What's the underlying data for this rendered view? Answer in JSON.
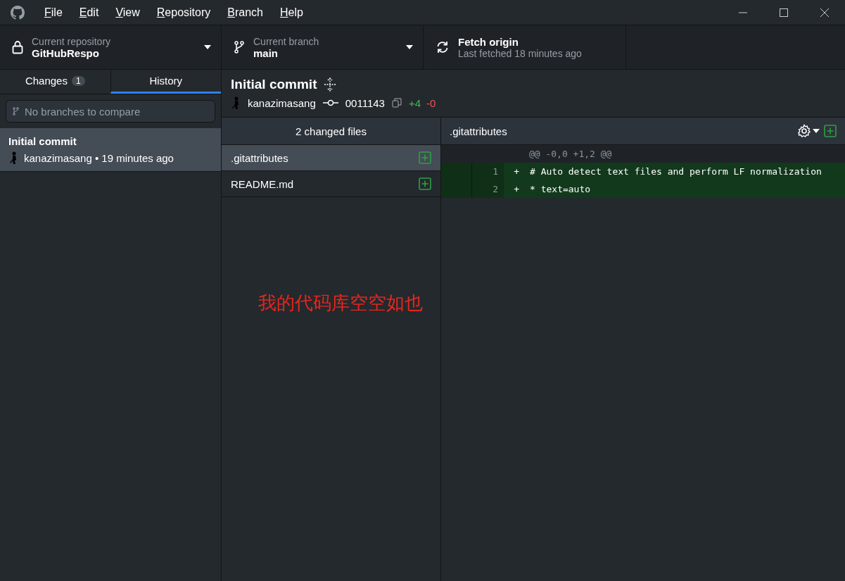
{
  "menu": [
    {
      "label": "File"
    },
    {
      "label": "Edit"
    },
    {
      "label": "View"
    },
    {
      "label": "Repository"
    },
    {
      "label": "Branch"
    },
    {
      "label": "Help"
    }
  ],
  "toolbar": {
    "repository": {
      "caption": "Current repository",
      "value": "GitHubRespo"
    },
    "branch": {
      "caption": "Current branch",
      "value": "main"
    },
    "fetch": {
      "caption": "Fetch origin",
      "value": "Last fetched 18 minutes ago"
    }
  },
  "tabs": [
    {
      "label": "Changes",
      "badge": "1",
      "selected": false
    },
    {
      "label": "History",
      "selected": true
    }
  ],
  "branch_filter": {
    "placeholder": "No branches to compare"
  },
  "commits": [
    {
      "title": "Initial commit",
      "author": "kanazimasang",
      "separator": "•",
      "time": "19 minutes ago",
      "selected": true
    }
  ],
  "commit": {
    "title": "Initial commit",
    "author": "kanazimasang",
    "sha": "0011143",
    "additions": "+4",
    "deletions": "-0"
  },
  "files": {
    "header": "2 changed files",
    "items": [
      {
        "name": ".gitattributes",
        "selected": true
      },
      {
        "name": "README.md",
        "selected": false
      }
    ]
  },
  "diff": {
    "file": ".gitattributes",
    "lines": [
      {
        "kind": "hunk",
        "text": "@@ -0,0 +1,2 @@"
      },
      {
        "kind": "add",
        "new": "1",
        "marker": "+",
        "text": "# Auto detect text files and perform LF normalization"
      },
      {
        "kind": "add",
        "new": "2",
        "marker": "+",
        "text": "* text=auto"
      }
    ]
  },
  "annotation": "我的代码库空空如也"
}
